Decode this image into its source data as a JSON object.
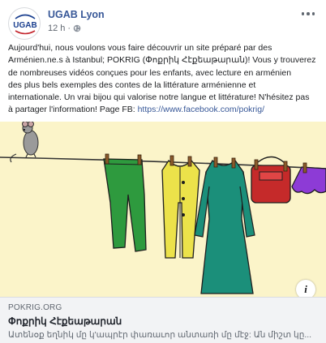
{
  "header": {
    "page_name": "UGAB Lyon",
    "timestamp": "12 h",
    "separator": "·",
    "avatar_text": "UGAB"
  },
  "post": {
    "text_lines": [
      "Aujourd'hui, nous voulons vous faire découvrir un site préparé par des",
      "Arménien.ne.s à Istanbul; POKRIG (Փոքրիկ Հէքեաթարան)! Vous y trouverez",
      "de nombreuses vidéos conçues pour les enfants, avec lecture en arménien",
      "des plus bels exemples des contes de la littérature arménienne et",
      "internationale. Un vrai bijou qui valorise notre langue et littérature! N'hésitez pas",
      "à partager l'information! Page FB: "
    ],
    "link_text": "https://www.facebook.com/pokrig/"
  },
  "link_preview": {
    "domain": "POKRIG.ORG",
    "title": "Փոքրիկ Հէքեաթարան",
    "description": "Ատենօք եղնիկ մը կ'ապրէր փառաւոր անտառի մը մէջ: Ան միշտ կը..."
  },
  "colors": {
    "link": "#385898",
    "image_background": "#fbf4c9",
    "preview_background": "#f2f3f5"
  },
  "icons": [
    "globe-icon",
    "more-options-icon",
    "info-icon",
    "mouse-illustration",
    "clothesline-illustration"
  ]
}
